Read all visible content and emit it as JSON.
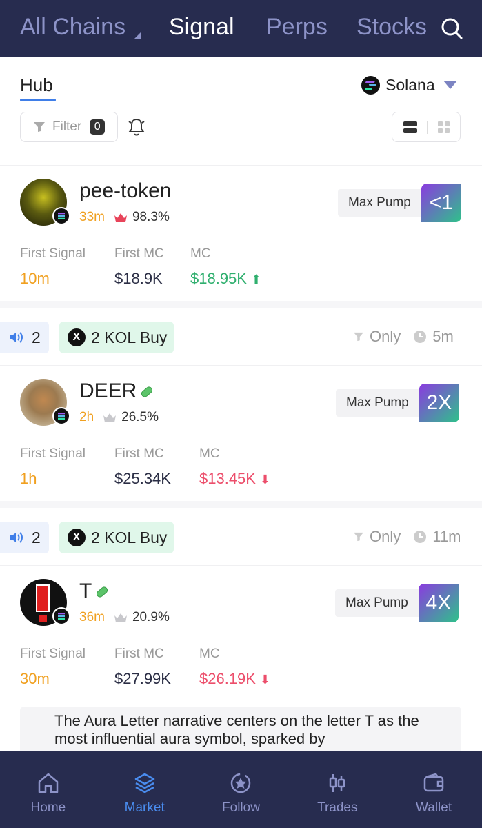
{
  "tabs": {
    "all_chains": "All Chains",
    "signal": "Signal",
    "perps": "Perps",
    "stocks": "Stocks"
  },
  "subheader": {
    "hub": "Hub",
    "chain": "Solana",
    "filter_label": "Filter",
    "filter_count": "0"
  },
  "tokens": [
    {
      "name": "pee-token",
      "age": "33m",
      "top_pct": "98.3%",
      "max_pump_label": "Max Pump",
      "max_pump": "<1",
      "first_signal_label": "First Signal",
      "first_signal": "10m",
      "first_mc_label": "First MC",
      "first_mc": "$18.9K",
      "mc_label": "MC",
      "mc": "$18.95K",
      "mc_trend": "up"
    },
    {
      "signal_count": "2",
      "kol_label": "2 KOL Buy",
      "only": "Only",
      "time": "5m",
      "name": "DEER",
      "age": "2h",
      "top_pct": "26.5%",
      "max_pump_label": "Max Pump",
      "max_pump": "2X",
      "first_signal_label": "First Signal",
      "first_signal": "1h",
      "first_mc_label": "First MC",
      "first_mc": "$25.34K",
      "mc_label": "MC",
      "mc": "$13.45K",
      "mc_trend": "down"
    },
    {
      "signal_count": "2",
      "kol_label": "2 KOL Buy",
      "only": "Only",
      "time": "11m",
      "name": "T",
      "age": "36m",
      "top_pct": "20.9%",
      "max_pump_label": "Max Pump",
      "max_pump": "4X",
      "first_signal_label": "First Signal",
      "first_signal": "30m",
      "first_mc_label": "First MC",
      "first_mc": "$27.99K",
      "mc_label": "MC",
      "mc": "$26.19K",
      "mc_trend": "down",
      "description": "The Aura Letter narrative centers on the letter T as the most influential aura symbol, sparked by"
    }
  ],
  "bottom_nav": {
    "home": "Home",
    "market": "Market",
    "follow": "Follow",
    "trades": "Trades",
    "wallet": "Wallet"
  },
  "colors": {
    "nav_bg": "#272c4f",
    "accent": "#3f7ee8",
    "up": "#2faf6e",
    "down": "#ec4e6b",
    "age": "#f0a020"
  }
}
